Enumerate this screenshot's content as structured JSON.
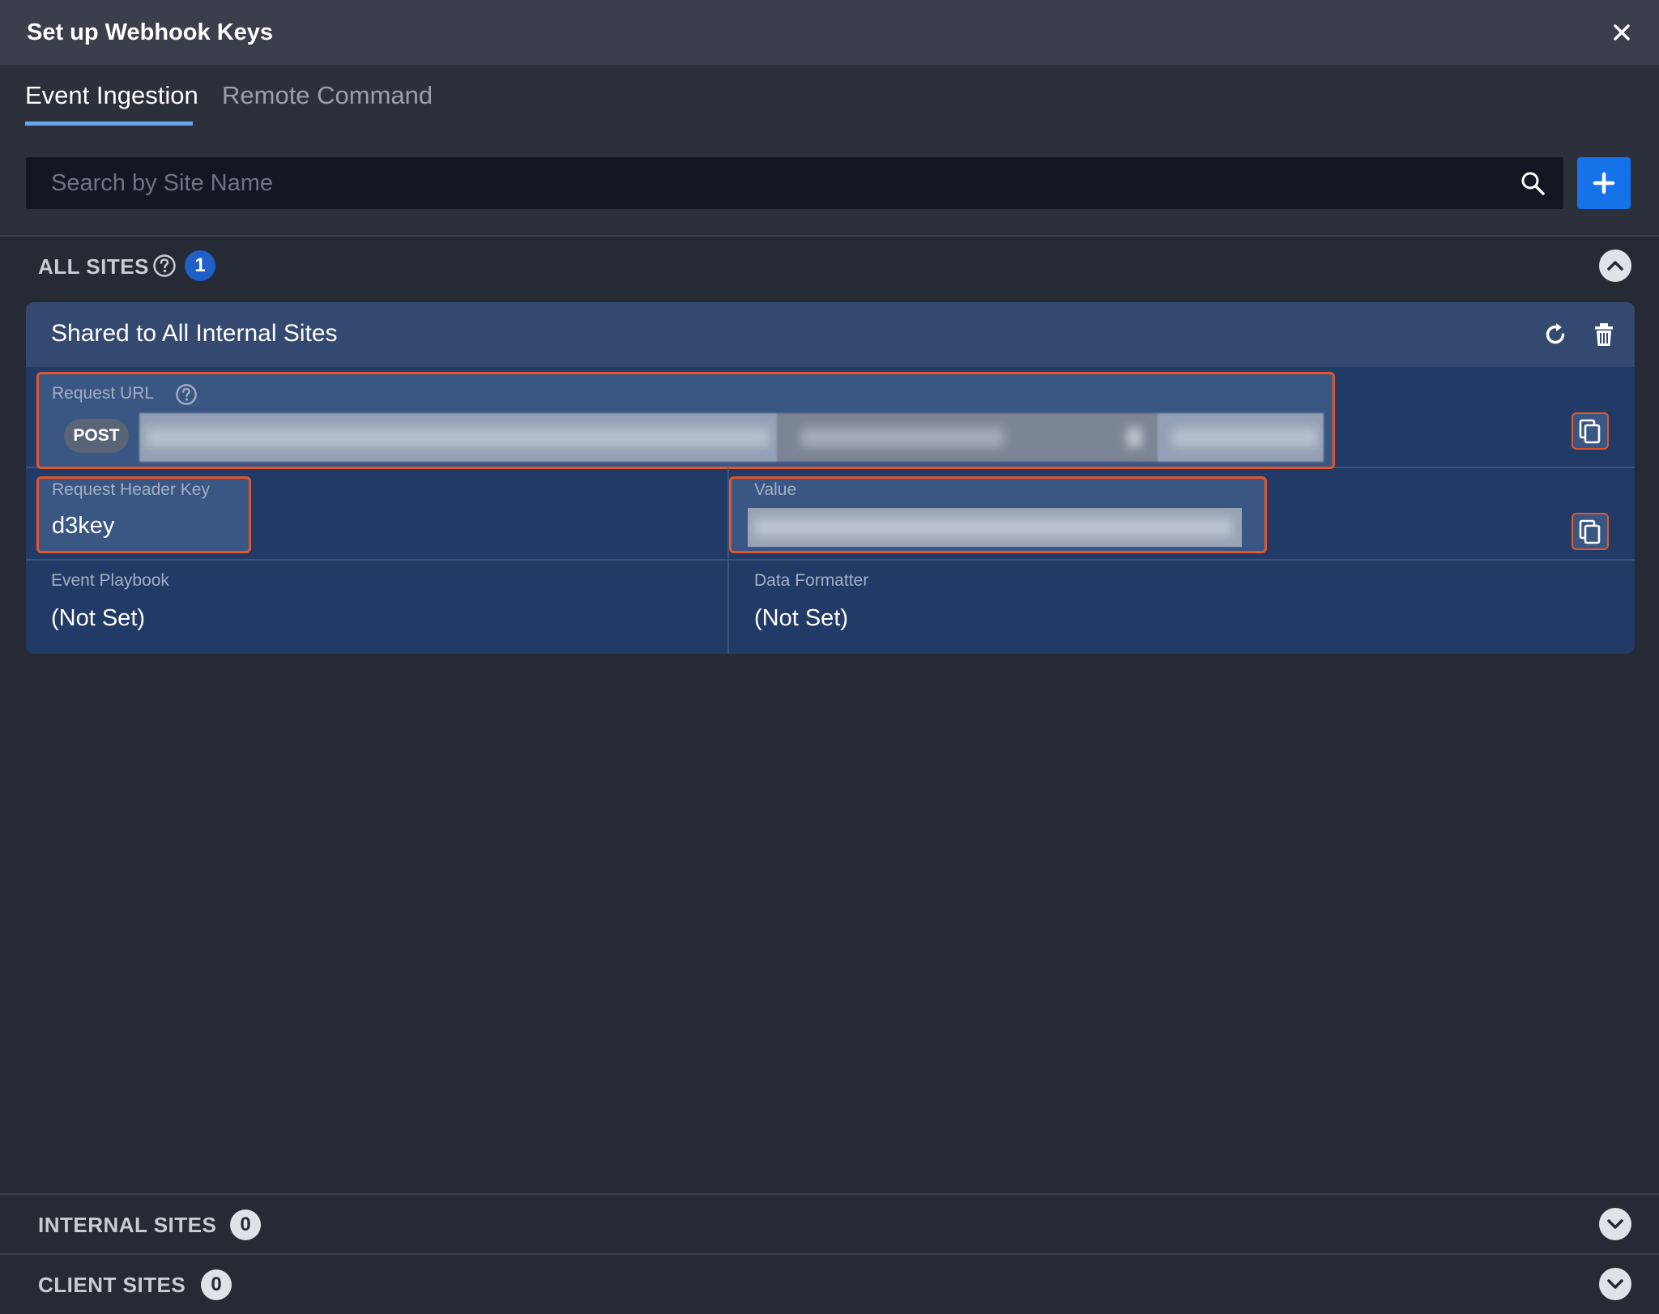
{
  "dialog": {
    "title": "Set up Webhook Keys"
  },
  "tabs": [
    {
      "label": "Event Ingestion",
      "active": true
    },
    {
      "label": "Remote Command",
      "active": false
    }
  ],
  "search": {
    "placeholder": "Search by Site Name",
    "value": ""
  },
  "sections": {
    "all_sites": {
      "title": "ALL SITES",
      "count": "1",
      "expanded": true
    },
    "internal_sites": {
      "title": "INTERNAL SITES",
      "count": "0",
      "expanded": false
    },
    "client_sites": {
      "title": "CLIENT SITES",
      "count": "0",
      "expanded": false
    }
  },
  "card": {
    "title": "Shared to All Internal Sites",
    "request_url": {
      "label": "Request URL",
      "method": "POST"
    },
    "header_key": {
      "label": "Request Header Key",
      "value": "d3key"
    },
    "header_value": {
      "label": "Value"
    },
    "event_playbook": {
      "label": "Event Playbook",
      "value": "(Not Set)"
    },
    "data_formatter": {
      "label": "Data Formatter",
      "value": "(Not Set)"
    }
  },
  "colors": {
    "accent": "#1572e8",
    "highlight_border": "#e2562e",
    "card_bg": "#223a66",
    "badge_blue": "#1f5fc8"
  },
  "icons": [
    "close-icon",
    "search-icon",
    "plus-icon",
    "help-icon",
    "chevron-up-icon",
    "chevron-down-icon",
    "refresh-icon",
    "trash-icon",
    "copy-icon"
  ]
}
